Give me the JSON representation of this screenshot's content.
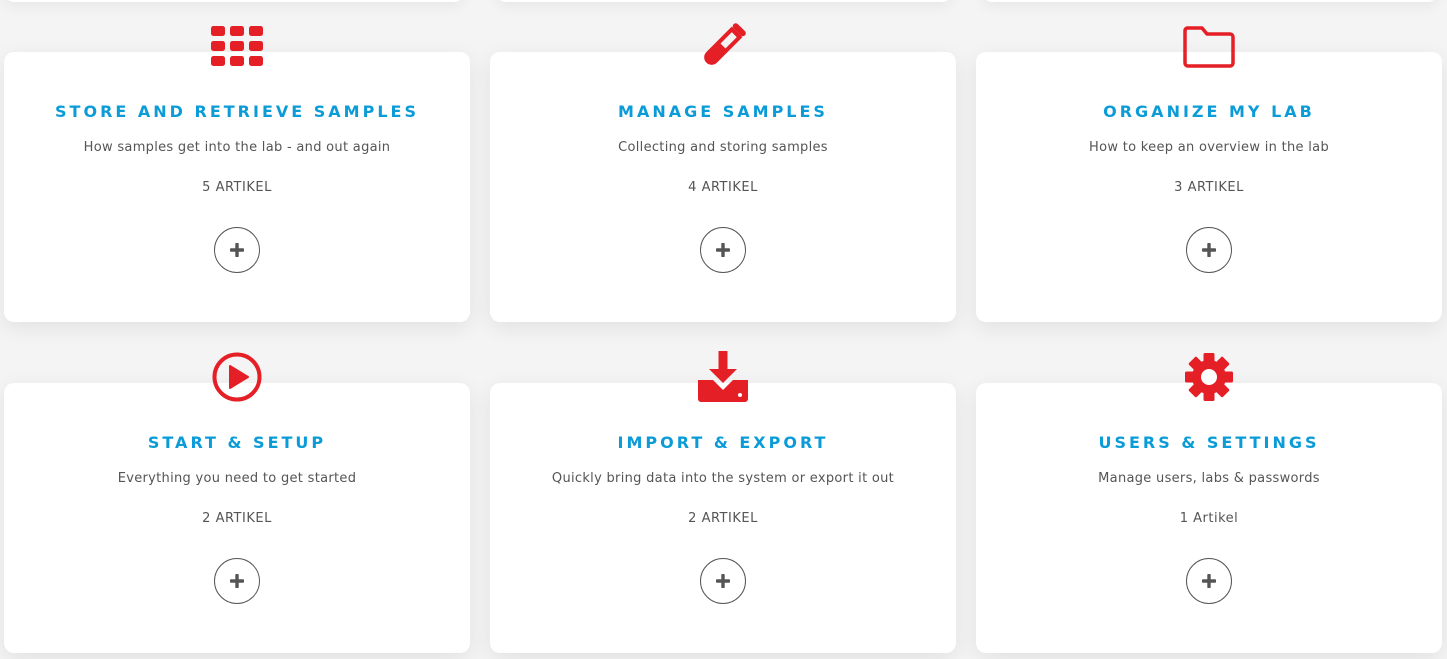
{
  "colors": {
    "accent_red": "#e41f26",
    "title_blue": "#0b9cd8",
    "text_gray": "#555555",
    "card_bg": "#ffffff",
    "page_bg": "#f4f4f5"
  },
  "categories": [
    {
      "icon": "grid-icon",
      "title": "STORE AND RETRIEVE SAMPLES",
      "description": "How samples get into the lab - and out again",
      "count": "5 ARTIKEL"
    },
    {
      "icon": "test-tube-icon",
      "title": "MANAGE SAMPLES",
      "description": "Collecting and storing samples",
      "count": "4 ARTIKEL"
    },
    {
      "icon": "folder-icon",
      "title": "ORGANIZE MY LAB",
      "description": "How to keep an overview in the lab",
      "count": "3 ARTIKEL"
    },
    {
      "icon": "play-circle-icon",
      "title": "START & SETUP",
      "description": "Everything you need to get started",
      "count": "2 ARTIKEL"
    },
    {
      "icon": "download-icon",
      "title": "IMPORT & EXPORT",
      "description": "Quickly bring data into the system or export it out",
      "count": "2 ARTIKEL"
    },
    {
      "icon": "gear-icon",
      "title": "USERS & SETTINGS",
      "description": "Manage users, labs & passwords",
      "count": "1 Artikel"
    }
  ]
}
